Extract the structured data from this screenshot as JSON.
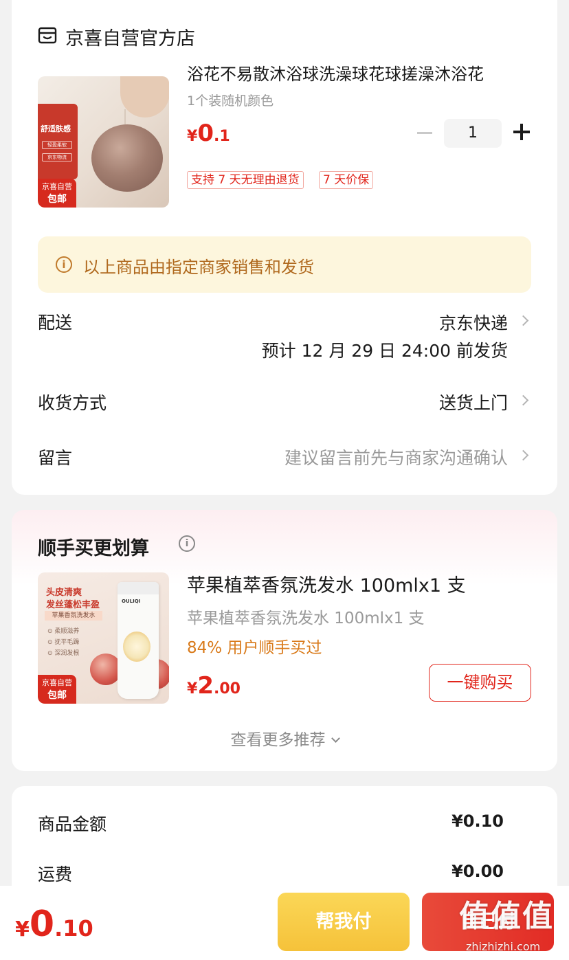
{
  "store": {
    "name": "京喜自营官方店",
    "icon": "store-icon"
  },
  "product": {
    "title": "浴花不易散沐浴球洗澡球花球搓澡沐浴花",
    "spec": "1个装随机颜色",
    "price_symbol": "¥",
    "price_int": "0",
    "price_dec": ".1",
    "quantity": "1",
    "service_tags": [
      "支持 7 天无理由退货",
      "7 天价保"
    ],
    "image_text": {
      "headline": "舒适肤感",
      "small_tag_1": "轻盈柔软",
      "small_tag_2": "京东物流",
      "badge_line1": "京喜自营",
      "badge_line2": "包邮"
    }
  },
  "notice": {
    "text": "以上商品由指定商家销售和发货",
    "icon": "info-icon"
  },
  "delivery": {
    "label": "配送",
    "carrier": "京东快递",
    "eta": "预计 12 月 29 日 24:00 前发货"
  },
  "receive": {
    "label": "收货方式",
    "value": "送货上门"
  },
  "message": {
    "label": "留言",
    "placeholder": "建议留言前先与商家沟通确认"
  },
  "recommend": {
    "title": "顺手买更划算",
    "item": {
      "title": "苹果植萃香氛洗发水 100mlx1 支",
      "spec": "苹果植萃香氛洗发水 100mlx1 支",
      "stat": "84% 用户顺手买过",
      "price_symbol": "¥",
      "price_int": "2",
      "price_dec": ".00",
      "buy_label": "一键购买",
      "image_text": {
        "headline1": "头皮清爽",
        "headline2": "发丝蓬松丰盈",
        "bar": "苹果香氛洗发水",
        "b1": "⊙ 柔顺滋养",
        "b2": "⊙ 抚平毛躁",
        "b3": "⊙ 深润发根",
        "brand": "OULIQI",
        "badge_line1": "京喜自营",
        "badge_line2": "包邮"
      }
    },
    "more_label": "查看更多推荐"
  },
  "summary": {
    "goods_label": "商品金额",
    "goods_value": "¥0.10",
    "freight_label": "运费",
    "freight_value": "¥0.00"
  },
  "bottom": {
    "price_symbol": "¥",
    "price_int": "0",
    "price_dec": ".10",
    "help_pay_label": "帮我付",
    "self_pay_label": "自己付"
  },
  "watermark": {
    "text": "值值值",
    "url": "zhizhizhi.com"
  },
  "colors": {
    "accent_red": "#e1251b",
    "notice_bg": "#fdf6dd",
    "notice_text": "#b0691e",
    "stat_orange": "#d97a1a",
    "help_yellow": "#f5c23a"
  }
}
